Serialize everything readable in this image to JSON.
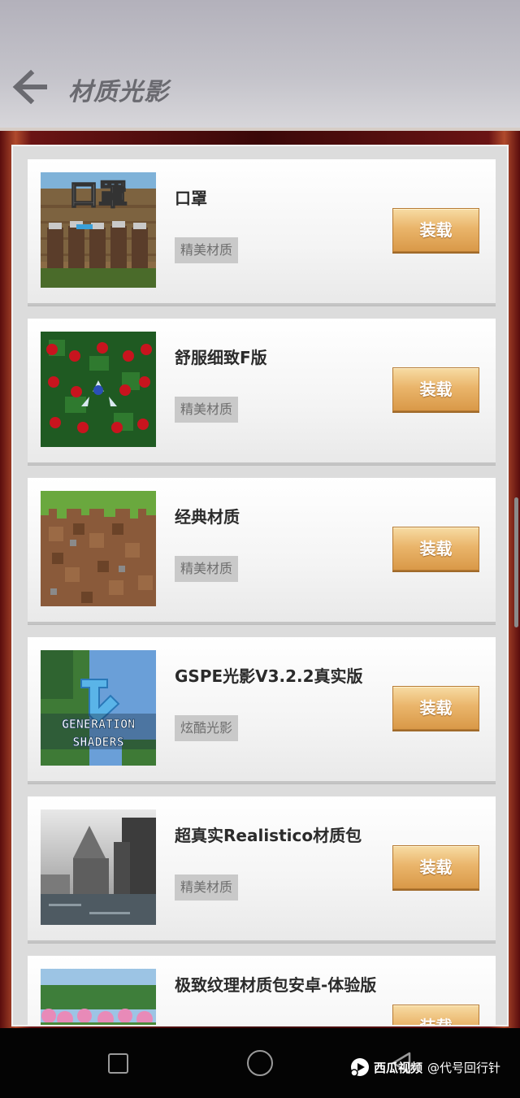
{
  "header": {
    "title": "材质光影",
    "back_icon": "arrow-left-icon"
  },
  "items": [
    {
      "title": "口罩",
      "tag": "精美材质",
      "button": "装载",
      "thumb": "mask-skin-thumbnail",
      "thumb_text": "口罩"
    },
    {
      "title": "舒服细致F版",
      "tag": "精美材质",
      "button": "装载",
      "thumb": "rose-bush-thumbnail"
    },
    {
      "title": "经典材质",
      "tag": "精美材质",
      "button": "装载",
      "thumb": "grass-block-thumbnail"
    },
    {
      "title": "GSPE光影V3.2.2真实版",
      "tag": "炫酷光影",
      "button": "装载",
      "thumb": "generation-shaders-thumbnail",
      "thumb_text": "GENERATION SHADERS"
    },
    {
      "title": "超真实Realistico材质包",
      "tag": "精美材质",
      "button": "装载",
      "thumb": "realistic-castle-thumbnail"
    },
    {
      "title": "极致纹理材质包安卓-体验版",
      "tag": "",
      "button": "装载",
      "thumb": "flower-field-thumbnail"
    }
  ],
  "navbar": {
    "recent_icon": "square-icon",
    "home_icon": "circle-icon",
    "back_icon": "triangle-back-icon"
  },
  "watermark": {
    "brand": "西瓜视频",
    "handle": "@代号回行针"
  },
  "colors": {
    "button_gold": "#eab56b",
    "header_gray": "#c4c3ca",
    "tag_gray": "#c9c9c9"
  }
}
